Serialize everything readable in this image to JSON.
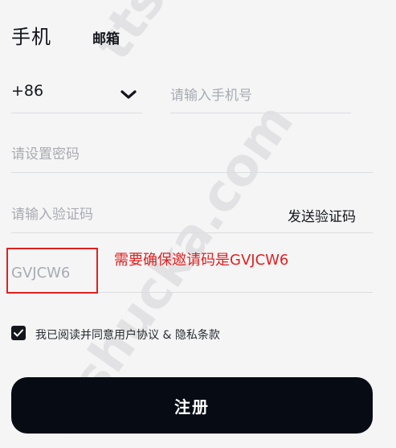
{
  "tabs": {
    "phone": "手机",
    "email": "邮箱"
  },
  "phone": {
    "country_code": "+86",
    "placeholder": "请输入手机号"
  },
  "password": {
    "placeholder": "请设置密码"
  },
  "verification": {
    "placeholder": "请输入验证码",
    "send_label": "发送验证码"
  },
  "invite": {
    "value": "GVJCW6",
    "annotation": "需要确保邀请码是GVJCW6"
  },
  "agreement": {
    "checked": true,
    "text": "我已阅读并同意用户协议 & 隐私条款"
  },
  "register_label": "注册",
  "watermark": {
    "top": "ttsh",
    "main": "ttshucka.com"
  },
  "colors": {
    "accent": "#070b13",
    "annotation": "#e02020",
    "placeholder": "#a9abb1"
  }
}
